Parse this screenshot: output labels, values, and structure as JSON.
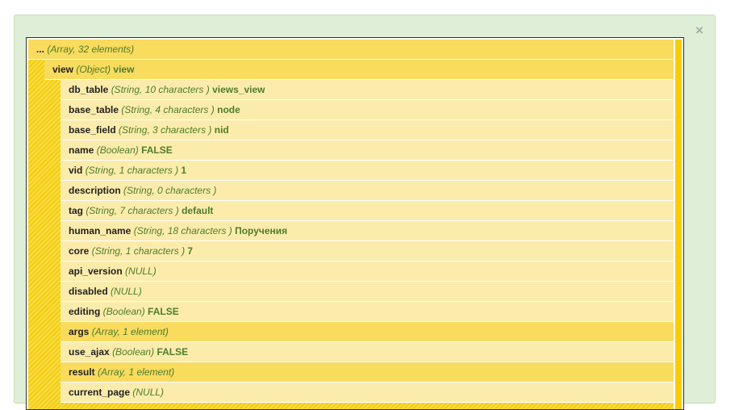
{
  "dialog": {
    "close_glyph": "×"
  },
  "tree": {
    "root": {
      "name": "...",
      "type": "(Array, 32 elements)",
      "value": ""
    },
    "view": {
      "name": "view",
      "type": "(Object)",
      "value": "view"
    },
    "items": [
      {
        "name": "db_table",
        "type": "(String, 10 characters )",
        "value": "views_view",
        "kind": "leaf"
      },
      {
        "name": "base_table",
        "type": "(String, 4 characters )",
        "value": "node",
        "kind": "leaf"
      },
      {
        "name": "base_field",
        "type": "(String, 3 characters )",
        "value": "nid",
        "kind": "leaf"
      },
      {
        "name": "name",
        "type": "(Boolean)",
        "value": "FALSE",
        "kind": "leaf"
      },
      {
        "name": "vid",
        "type": "(String, 1 characters )",
        "value": "1",
        "kind": "leaf"
      },
      {
        "name": "description",
        "type": "(String, 0 characters )",
        "value": "",
        "kind": "leaf"
      },
      {
        "name": "tag",
        "type": "(String, 7 characters )",
        "value": "default",
        "kind": "leaf"
      },
      {
        "name": "human_name",
        "type": "(String, 18 characters )",
        "value": "Поручения",
        "kind": "leaf"
      },
      {
        "name": "core",
        "type": "(String, 1 characters )",
        "value": "7",
        "kind": "leaf"
      },
      {
        "name": "api_version",
        "type": "(NULL)",
        "value": "",
        "kind": "leaf"
      },
      {
        "name": "disabled",
        "type": "(NULL)",
        "value": "",
        "kind": "leaf"
      },
      {
        "name": "editing",
        "type": "(Boolean)",
        "value": "FALSE",
        "kind": "leaf"
      },
      {
        "name": "args",
        "type": "(Array, 1 element)",
        "value": "",
        "kind": "collapsed"
      },
      {
        "name": "use_ajax",
        "type": "(Boolean)",
        "value": "FALSE",
        "kind": "leaf"
      },
      {
        "name": "result",
        "type": "(Array, 1 element)",
        "value": "",
        "kind": "collapsed"
      },
      {
        "name": "current_page",
        "type": "(NULL)",
        "value": "",
        "kind": "leaf"
      }
    ]
  },
  "colors": {
    "panel_bg": "#dfeed6",
    "collapsed_row": "#f9db5e",
    "leaf_row": "#fcecab",
    "type_text": "#4d7d2c",
    "rail": "#f8cd00"
  }
}
